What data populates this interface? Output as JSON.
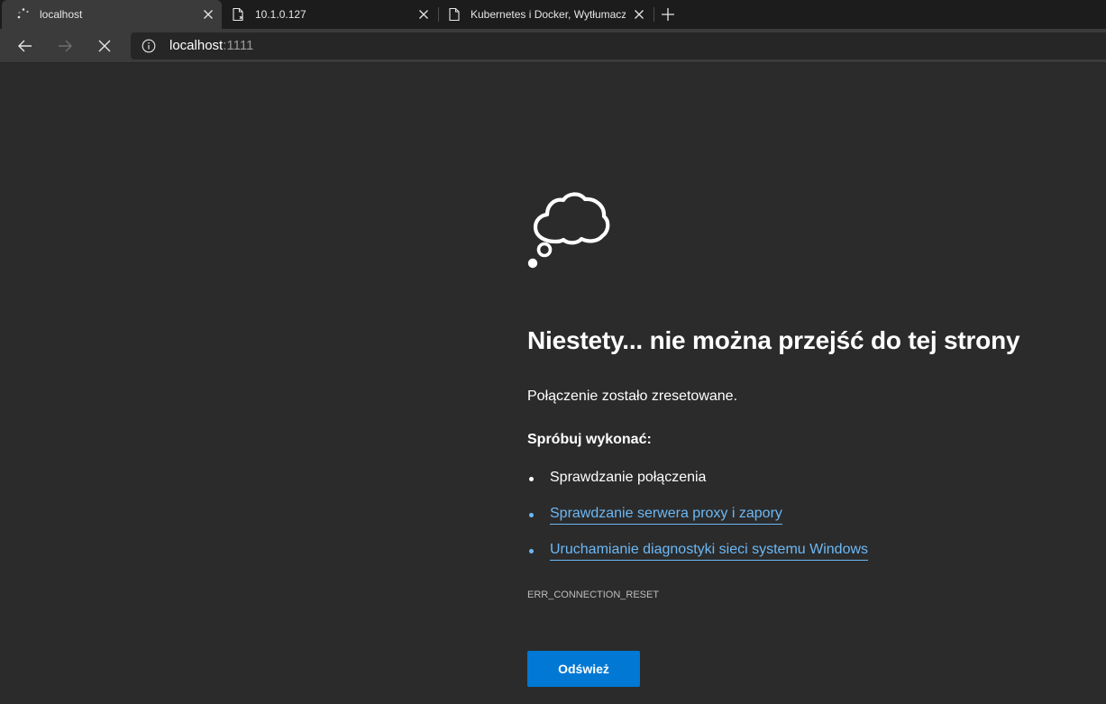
{
  "tabs": [
    {
      "title": "localhost",
      "icon": "loading-spinner-icon",
      "active": true
    },
    {
      "title": "10.1.0.127",
      "icon": "page-error-icon",
      "active": false
    },
    {
      "title": "Kubernetes i Docker, Wytłumacz",
      "icon": "page-icon",
      "active": false
    }
  ],
  "address_bar": {
    "host": "localhost",
    "port": ":1111",
    "icon": "info-icon"
  },
  "toolbar": {
    "back_icon": "arrow-left-icon",
    "forward_icon": "arrow-right-icon",
    "stop_icon": "close-icon"
  },
  "error_page": {
    "icon": "thought-cloud-icon",
    "headline": "Niestety... nie można przejść do tej strony",
    "message": "Połączenie zostało zresetowane.",
    "try_heading": "Spróbuj wykonać:",
    "suggestions": [
      {
        "label": "Sprawdzanie połączenia",
        "is_link": false
      },
      {
        "label": "Sprawdzanie serwera proxy i zapory",
        "is_link": true
      },
      {
        "label": "Uruchamianie diagnostyki sieci systemu Windows",
        "is_link": true
      }
    ],
    "error_code": "ERR_CONNECTION_RESET",
    "refresh_label": "Odśwież"
  },
  "colors": {
    "page_bg": "#2b2b2b",
    "tabstrip_bg": "#1c1c1c",
    "toolbar_bg": "#3b3b3b",
    "link": "#6cb8f6",
    "button": "#0078d4"
  }
}
